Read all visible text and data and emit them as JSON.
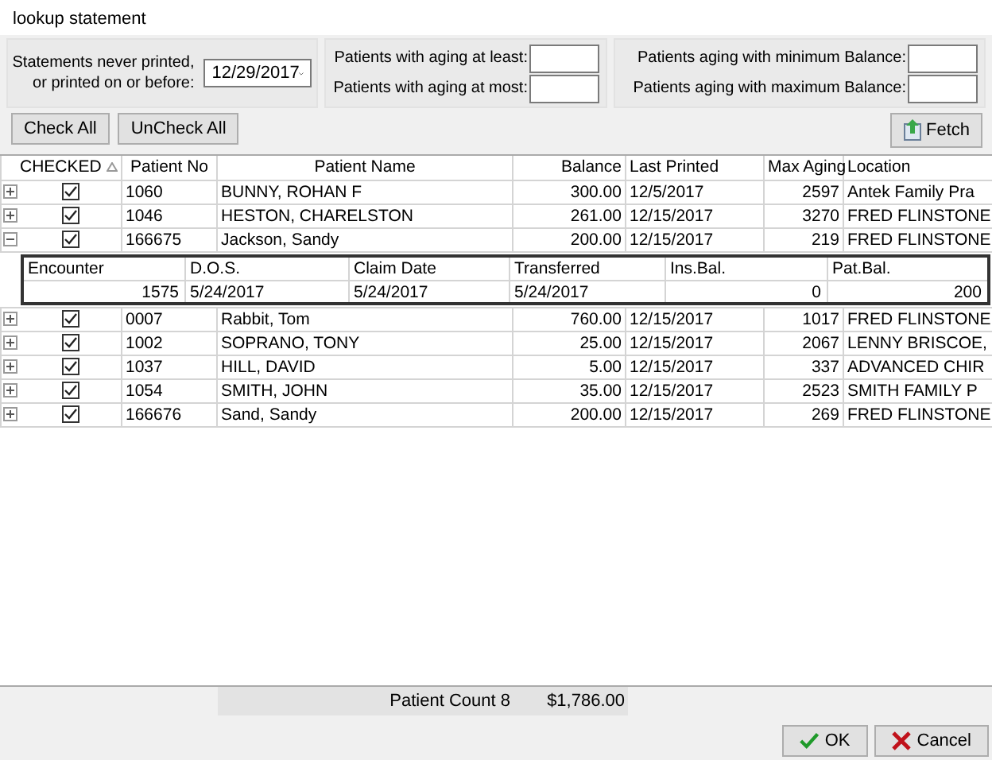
{
  "window": {
    "title": "lookup statement"
  },
  "filters": {
    "date_label_lines": [
      "Statements never printed,",
      "or printed on or before:"
    ],
    "date_value": "12/29/2017",
    "aging_fields": [
      {
        "label": "Patients with aging at least:"
      },
      {
        "label": "Patients with aging at most:"
      }
    ],
    "balance_fields": [
      {
        "label": "Patients aging with minimum Balance:"
      },
      {
        "label": "Patients aging with maximum Balance:"
      }
    ]
  },
  "actions": {
    "check_all": "Check All",
    "uncheck_all": "UnCheck All",
    "fetch": "Fetch"
  },
  "table": {
    "columns": [
      "CHECKED",
      "Patient No",
      "Patient Name",
      "Balance",
      "Last Printed",
      "Max Aging",
      "Location"
    ],
    "rows": [
      {
        "checked": true,
        "expanded": false,
        "patient_no": "1060",
        "name": "BUNNY, ROHAN F",
        "balance": "300.00",
        "last_printed": "12/5/2017",
        "max_aging": "2597",
        "location": "Antek Family Pra"
      },
      {
        "checked": true,
        "expanded": false,
        "patient_no": "1046",
        "name": "HESTON, CHARELSTON",
        "balance": "261.00",
        "last_printed": "12/15/2017",
        "max_aging": "3270",
        "location": "FRED FLINSTONE"
      },
      {
        "checked": true,
        "expanded": true,
        "patient_no": "166675",
        "name": "Jackson, Sandy",
        "balance": "200.00",
        "last_printed": "12/15/2017",
        "max_aging": "219",
        "location": "FRED FLINSTONE",
        "details": {
          "columns": [
            "Encounter",
            "D.O.S.",
            "Claim Date",
            "Transferred",
            "Ins.Bal.",
            "Pat.Bal."
          ],
          "values": [
            "1575",
            "5/24/2017",
            "5/24/2017",
            "5/24/2017",
            "0",
            "200"
          ]
        }
      },
      {
        "checked": true,
        "expanded": false,
        "patient_no": "0007",
        "name": "Rabbit, Tom",
        "balance": "760.00",
        "last_printed": "12/15/2017",
        "max_aging": "1017",
        "location": "FRED FLINSTONE"
      },
      {
        "checked": true,
        "expanded": false,
        "patient_no": "1002",
        "name": "SOPRANO, TONY",
        "balance": "25.00",
        "last_printed": "12/15/2017",
        "max_aging": "2067",
        "location": "LENNY BRISCOE,"
      },
      {
        "checked": true,
        "expanded": false,
        "patient_no": "1037",
        "name": "HILL, DAVID",
        "balance": "5.00",
        "last_printed": "12/15/2017",
        "max_aging": "337",
        "location": "ADVANCED CHIR"
      },
      {
        "checked": true,
        "expanded": false,
        "patient_no": "1054",
        "name": "SMITH, JOHN",
        "balance": "35.00",
        "last_printed": "12/15/2017",
        "max_aging": "2523",
        "location": "SMITH FAMILY P"
      },
      {
        "checked": true,
        "expanded": false,
        "patient_no": "166676",
        "name": "Sand, Sandy",
        "balance": "200.00",
        "last_printed": "12/15/2017",
        "max_aging": "269",
        "location": "FRED FLINSTONE"
      }
    ]
  },
  "footer": {
    "count": "Patient Count 8",
    "total": "$1,786.00"
  },
  "dialog_buttons": {
    "ok": "OK",
    "cancel": "Cancel"
  }
}
